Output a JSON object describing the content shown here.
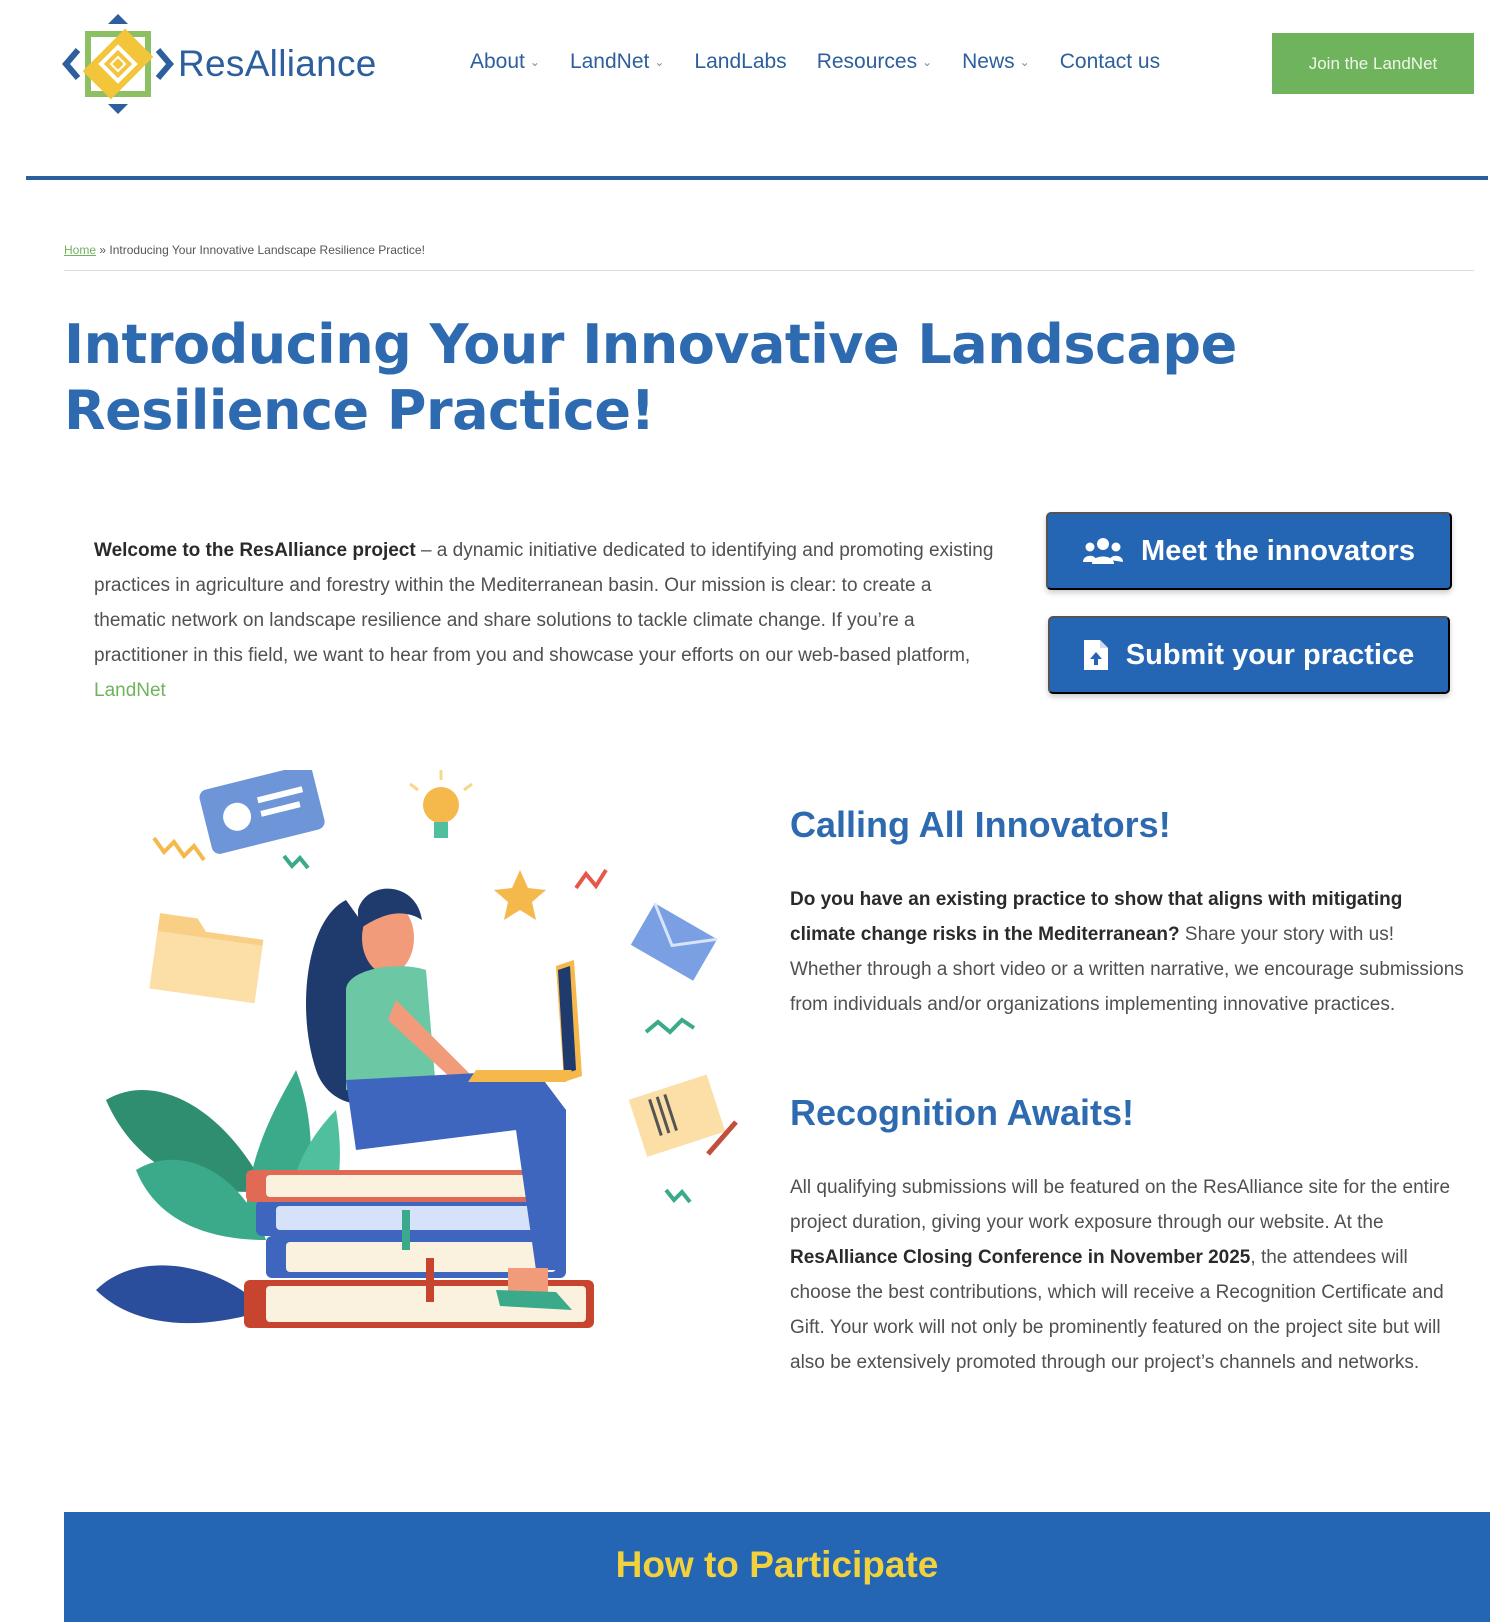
{
  "header": {
    "brand": "ResAlliance",
    "nav": [
      {
        "label": "About",
        "has_dropdown": true
      },
      {
        "label": "LandNet",
        "has_dropdown": true
      },
      {
        "label": "LandLabs",
        "has_dropdown": false
      },
      {
        "label": "Resources",
        "has_dropdown": true
      },
      {
        "label": "News",
        "has_dropdown": true
      },
      {
        "label": "Contact us",
        "has_dropdown": false
      }
    ],
    "join_label": "Join the LandNet"
  },
  "breadcrumb": {
    "home": "Home",
    "separator": "»",
    "current": "Introducing Your Innovative Landscape Resilience Practice!"
  },
  "page": {
    "title": "Introducing Your Innovative Landscape Resilience Practice!"
  },
  "intro": {
    "lead": "Welcome to the ResAlliance project",
    "text": " – a dynamic initiative dedicated to identifying and promoting existing practices in agriculture and forestry within the Mediterranean basin. Our mission is clear: to create a thematic network on landscape resilience and share solutions to tackle climate change. If you’re a practitioner in this field, we want to hear from you and showcase your efforts on our web-based platform, ",
    "link": "LandNet"
  },
  "cta": {
    "meet": "Meet the innovators",
    "submit": "Submit your practice"
  },
  "calling": {
    "heading": "Calling All Innovators!",
    "bold": "Do you have an existing practice to show that aligns with mitigating climate change risks in the Mediterranean?",
    "text": " Share your story with us! Whether through a short video or a written narrative, we encourage submissions from individuals and/or organizations implementing innovative practices."
  },
  "recognition": {
    "heading": "Recognition Awaits!",
    "text1": "All qualifying submissions will be featured on the ResAlliance site for the entire project duration, giving your work exposure through our website. At the ",
    "bold": "ResAlliance Closing Conference in November 2025",
    "text2": ", the attendees will choose the best contributions, which will receive a Recognition Certificate and Gift. Your work will not only be prominently featured on the project site but will also be extensively promoted through our project’s channels and networks."
  },
  "participate": {
    "title": "How to Participate"
  },
  "colors": {
    "brand_blue": "#2d6ab0",
    "button_blue": "#2466b3",
    "green": "#6fb35d",
    "yellow": "#f2d23c"
  }
}
